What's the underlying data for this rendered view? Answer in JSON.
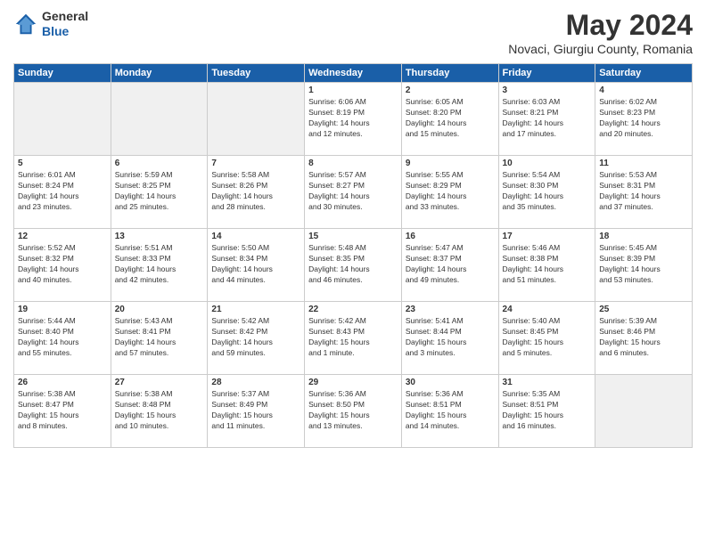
{
  "header": {
    "logo": {
      "general": "General",
      "blue": "Blue"
    },
    "title": "May 2024",
    "location": "Novaci, Giurgiu County, Romania"
  },
  "weekdays": [
    "Sunday",
    "Monday",
    "Tuesday",
    "Wednesday",
    "Thursday",
    "Friday",
    "Saturday"
  ],
  "weeks": [
    [
      {
        "day": "",
        "info": ""
      },
      {
        "day": "",
        "info": ""
      },
      {
        "day": "",
        "info": ""
      },
      {
        "day": "1",
        "info": "Sunrise: 6:06 AM\nSunset: 8:19 PM\nDaylight: 14 hours\nand 12 minutes."
      },
      {
        "day": "2",
        "info": "Sunrise: 6:05 AM\nSunset: 8:20 PM\nDaylight: 14 hours\nand 15 minutes."
      },
      {
        "day": "3",
        "info": "Sunrise: 6:03 AM\nSunset: 8:21 PM\nDaylight: 14 hours\nand 17 minutes."
      },
      {
        "day": "4",
        "info": "Sunrise: 6:02 AM\nSunset: 8:23 PM\nDaylight: 14 hours\nand 20 minutes."
      }
    ],
    [
      {
        "day": "5",
        "info": "Sunrise: 6:01 AM\nSunset: 8:24 PM\nDaylight: 14 hours\nand 23 minutes."
      },
      {
        "day": "6",
        "info": "Sunrise: 5:59 AM\nSunset: 8:25 PM\nDaylight: 14 hours\nand 25 minutes."
      },
      {
        "day": "7",
        "info": "Sunrise: 5:58 AM\nSunset: 8:26 PM\nDaylight: 14 hours\nand 28 minutes."
      },
      {
        "day": "8",
        "info": "Sunrise: 5:57 AM\nSunset: 8:27 PM\nDaylight: 14 hours\nand 30 minutes."
      },
      {
        "day": "9",
        "info": "Sunrise: 5:55 AM\nSunset: 8:29 PM\nDaylight: 14 hours\nand 33 minutes."
      },
      {
        "day": "10",
        "info": "Sunrise: 5:54 AM\nSunset: 8:30 PM\nDaylight: 14 hours\nand 35 minutes."
      },
      {
        "day": "11",
        "info": "Sunrise: 5:53 AM\nSunset: 8:31 PM\nDaylight: 14 hours\nand 37 minutes."
      }
    ],
    [
      {
        "day": "12",
        "info": "Sunrise: 5:52 AM\nSunset: 8:32 PM\nDaylight: 14 hours\nand 40 minutes."
      },
      {
        "day": "13",
        "info": "Sunrise: 5:51 AM\nSunset: 8:33 PM\nDaylight: 14 hours\nand 42 minutes."
      },
      {
        "day": "14",
        "info": "Sunrise: 5:50 AM\nSunset: 8:34 PM\nDaylight: 14 hours\nand 44 minutes."
      },
      {
        "day": "15",
        "info": "Sunrise: 5:48 AM\nSunset: 8:35 PM\nDaylight: 14 hours\nand 46 minutes."
      },
      {
        "day": "16",
        "info": "Sunrise: 5:47 AM\nSunset: 8:37 PM\nDaylight: 14 hours\nand 49 minutes."
      },
      {
        "day": "17",
        "info": "Sunrise: 5:46 AM\nSunset: 8:38 PM\nDaylight: 14 hours\nand 51 minutes."
      },
      {
        "day": "18",
        "info": "Sunrise: 5:45 AM\nSunset: 8:39 PM\nDaylight: 14 hours\nand 53 minutes."
      }
    ],
    [
      {
        "day": "19",
        "info": "Sunrise: 5:44 AM\nSunset: 8:40 PM\nDaylight: 14 hours\nand 55 minutes."
      },
      {
        "day": "20",
        "info": "Sunrise: 5:43 AM\nSunset: 8:41 PM\nDaylight: 14 hours\nand 57 minutes."
      },
      {
        "day": "21",
        "info": "Sunrise: 5:42 AM\nSunset: 8:42 PM\nDaylight: 14 hours\nand 59 minutes."
      },
      {
        "day": "22",
        "info": "Sunrise: 5:42 AM\nSunset: 8:43 PM\nDaylight: 15 hours\nand 1 minute."
      },
      {
        "day": "23",
        "info": "Sunrise: 5:41 AM\nSunset: 8:44 PM\nDaylight: 15 hours\nand 3 minutes."
      },
      {
        "day": "24",
        "info": "Sunrise: 5:40 AM\nSunset: 8:45 PM\nDaylight: 15 hours\nand 5 minutes."
      },
      {
        "day": "25",
        "info": "Sunrise: 5:39 AM\nSunset: 8:46 PM\nDaylight: 15 hours\nand 6 minutes."
      }
    ],
    [
      {
        "day": "26",
        "info": "Sunrise: 5:38 AM\nSunset: 8:47 PM\nDaylight: 15 hours\nand 8 minutes."
      },
      {
        "day": "27",
        "info": "Sunrise: 5:38 AM\nSunset: 8:48 PM\nDaylight: 15 hours\nand 10 minutes."
      },
      {
        "day": "28",
        "info": "Sunrise: 5:37 AM\nSunset: 8:49 PM\nDaylight: 15 hours\nand 11 minutes."
      },
      {
        "day": "29",
        "info": "Sunrise: 5:36 AM\nSunset: 8:50 PM\nDaylight: 15 hours\nand 13 minutes."
      },
      {
        "day": "30",
        "info": "Sunrise: 5:36 AM\nSunset: 8:51 PM\nDaylight: 15 hours\nand 14 minutes."
      },
      {
        "day": "31",
        "info": "Sunrise: 5:35 AM\nSunset: 8:51 PM\nDaylight: 15 hours\nand 16 minutes."
      },
      {
        "day": "",
        "info": ""
      }
    ]
  ]
}
